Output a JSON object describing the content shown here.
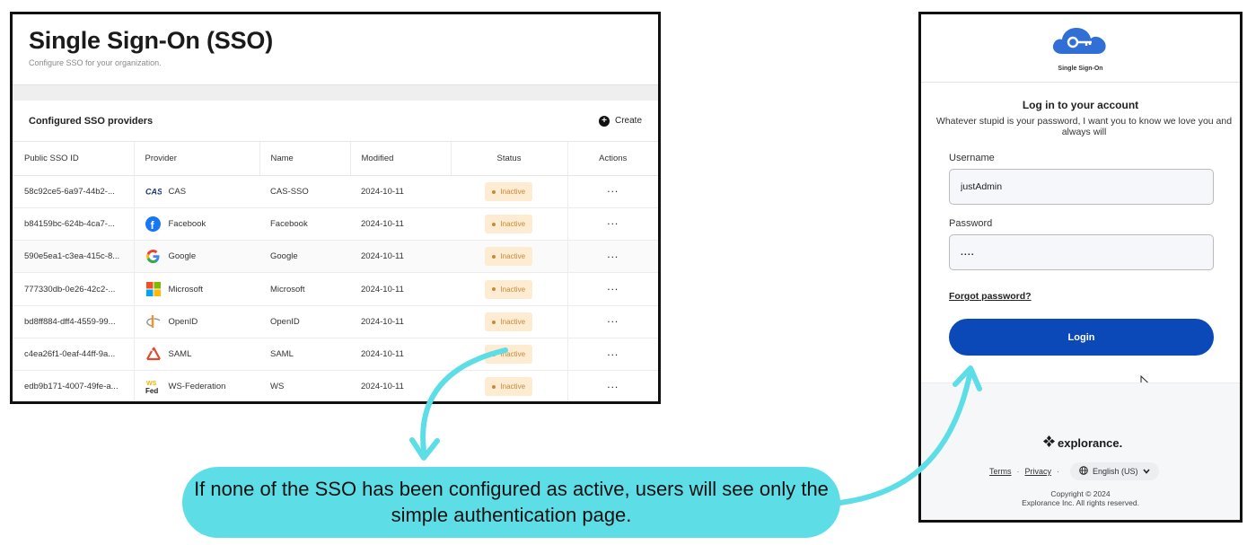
{
  "admin": {
    "title": "Single Sign-On (SSO)",
    "subtitle": "Configure SSO for your organization.",
    "card_title": "Configured SSO providers",
    "create_label": "Create",
    "columns": [
      "Public SSO ID",
      "Provider",
      "Name",
      "Modified",
      "Status",
      "Actions"
    ],
    "rows": [
      {
        "id": "58c92ce5-6a97-44b2-...",
        "provider": "CAS",
        "logo": "cas-logo-icon",
        "name": "CAS-SSO",
        "modified": "2024-10-11",
        "status": "Inactive",
        "actions": "..."
      },
      {
        "id": "b84159bc-624b-4ca7-...",
        "provider": "Facebook",
        "logo": "facebook-logo-icon",
        "name": "Facebook",
        "modified": "2024-10-11",
        "status": "Inactive",
        "actions": "..."
      },
      {
        "id": "590e5ea1-c3ea-415c-8...",
        "provider": "Google",
        "logo": "google-logo-icon",
        "name": "Google",
        "modified": "2024-10-11",
        "status": "Inactive",
        "actions": "..."
      },
      {
        "id": "777330db-0e26-42c2-...",
        "provider": "Microsoft",
        "logo": "microsoft-logo-icon",
        "name": "Microsoft",
        "modified": "2024-10-11",
        "status": "Inactive",
        "actions": "..."
      },
      {
        "id": "bd8ff884-dff4-4559-99...",
        "provider": "OpenID",
        "logo": "openid-logo-icon",
        "name": "OpenID",
        "modified": "2024-10-11",
        "status": "Inactive",
        "actions": "..."
      },
      {
        "id": "c4ea26f1-0eaf-44ff-9a...",
        "provider": "SAML",
        "logo": "saml-logo-icon",
        "name": "SAML",
        "modified": "2024-10-11",
        "status": "Inactive",
        "actions": "..."
      },
      {
        "id": "edb9b171-4007-49fe-a...",
        "provider": "WS-Federation",
        "logo": "ws-fed-logo-icon",
        "name": "WS",
        "modified": "2024-10-11",
        "status": "Inactive",
        "actions": "..."
      }
    ],
    "colors": {
      "badge_bg": "#fdebd2",
      "badge_text": "#c78a3a"
    }
  },
  "login": {
    "brand_label": "Single Sign-On",
    "title": "Log in to your account",
    "description": "Whatever stupid is your password, I want you to know we love you and always will",
    "username_label": "Username",
    "username_value": "justAdmin",
    "password_label": "Password",
    "password_value": "....",
    "forgot_label": "Forgot password?",
    "login_label": "Login",
    "footer_brand": "explorance.",
    "terms_label": "Terms",
    "privacy_label": "Privacy",
    "language_label": "English (US)",
    "copyright_line1": "Copyright © 2024",
    "copyright_line2": "Explorance Inc. All rights reserved.",
    "colors": {
      "primary": "#0b49b8",
      "brand_cloud": "#2f6fd6"
    }
  },
  "callout": {
    "text": "If none of the SSO has been configured as active, users will see only the simple authentication page.",
    "color": "#5ddee6"
  }
}
